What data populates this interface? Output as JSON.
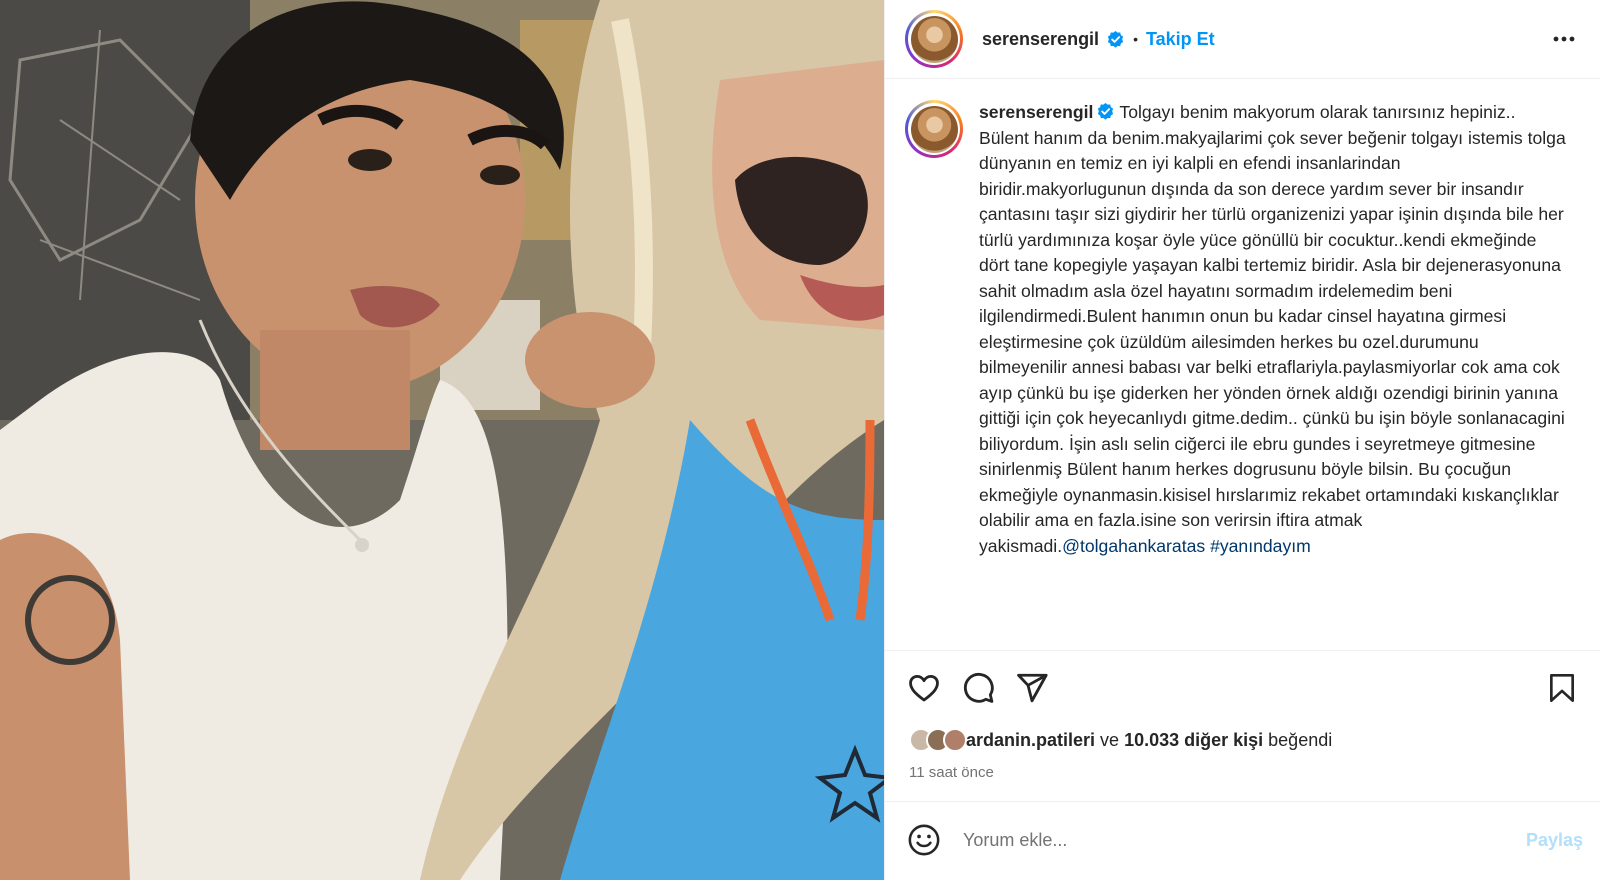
{
  "post": {
    "username": "serenserengil",
    "separator": "•",
    "follow_label": "Takip Et",
    "caption": {
      "username": "serenserengil",
      "body": "Tolgayı benim makyorum olarak tanırsınız hepiniz.. Bülent hanım da benim.makyajlarimi çok sever beğenir tolgayı istemis tolga dünyanın en temiz en iyi kalpli en efendi insanlarindan biridir.makyorlugunun dışında da son derece yardım sever bir insandır çantasını taşır sizi giydirir her türlü organizenizi yapar işinin dışında bile her türlü yardımınıza koşar öyle yüce gönüllü bir cocuktur..kendi ekmeğinde dört tane kopegiyle yaşayan kalbi tertemiz biridir. Asla bir dejenerasyonuna sahit olmadım asla özel hayatını sormadım irdelemedim beni ilgilendirmedi.Bulent hanımın onun bu kadar cinsel hayatına girmesi eleştirmesine çok üzüldüm ailesimden herkes bu ozel.durumunu bilmeyenilir annesi babası var belki etraflariyla.paylasmiyorlar cok ama cok ayıp çünkü bu işe giderken her yönden örnek aldığı ozendigi birinin yanına gittiği için çok heyecanlıydı gitme.dedim.. çünkü bu işin böyle sonlanacagini biliyordum. İşin aslı selin ciğerci ile ebru gundes i seyretmeye gitmesine sinirlenmiş Bülent hanım herkes dogrusunu böyle bilsin. Bu çocuğun ekmeğiyle oynanmasin.kisisel hırslarımiz rekabet ortamındaki kıskançlıklar olabilir ama en fazla.isine son verirsin iftira atmak yakismadi.",
      "mention": "@tolgahankaratas",
      "hashtag": "#yanındayım"
    },
    "likes": {
      "first_liker": "ardanin.patileri",
      "connector": "ve",
      "count_text": "10.033 diğer kişi",
      "suffix": "beğendi"
    },
    "time_ago": "11 saat önce",
    "comment": {
      "placeholder": "Yorum ekle...",
      "post_label": "Paylaş"
    }
  },
  "icons": {
    "verified": "verified-badge-icon",
    "more": "more-options-icon",
    "like": "heart-icon",
    "comment": "comment-icon",
    "share": "share-icon",
    "save": "bookmark-icon",
    "emoji": "emoji-icon"
  },
  "colors": {
    "accent": "#0095f6",
    "link": "#00376b",
    "muted": "#737373",
    "post_disabled": "#b2dffc",
    "verified": "#0095f6"
  }
}
